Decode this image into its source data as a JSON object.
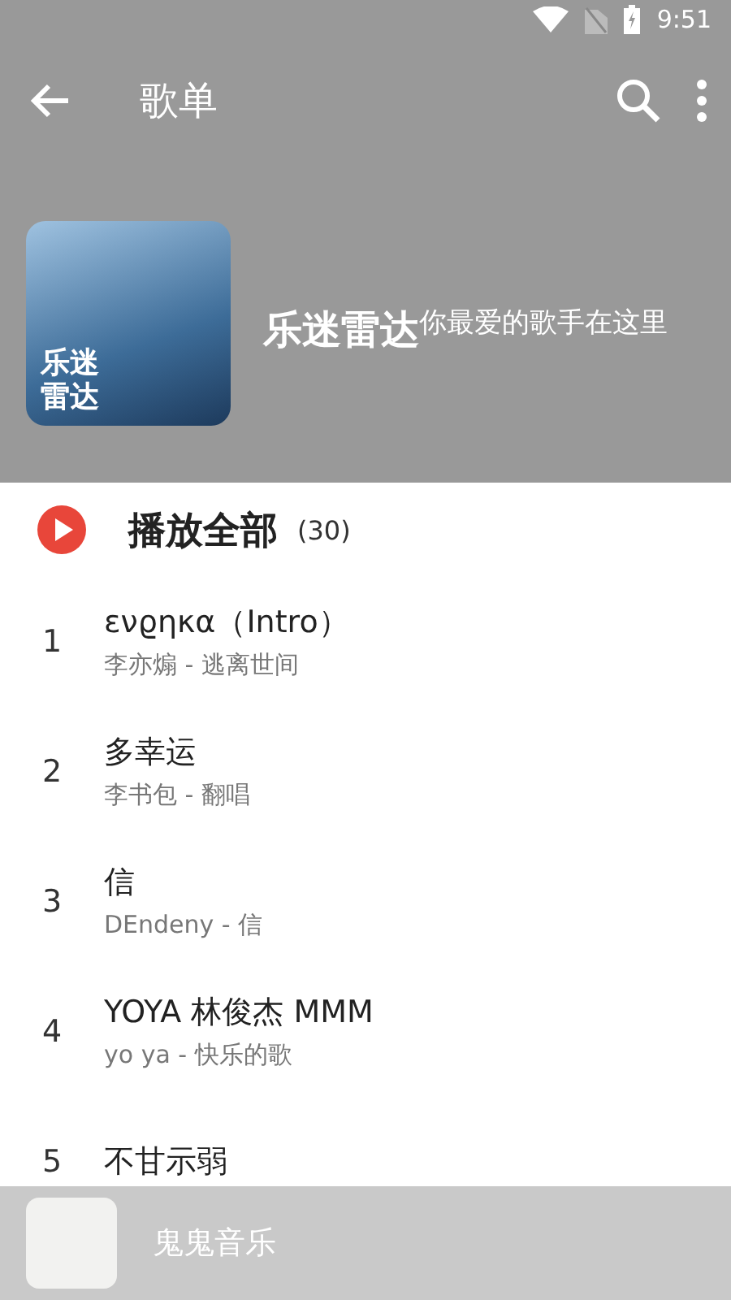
{
  "status_bar": {
    "time": "9:51"
  },
  "app_bar": {
    "title": "歌单"
  },
  "playlist": {
    "title": "乐迷雷达",
    "description": "你最爱的歌手在这里",
    "cover_lines": [
      "乐迷",
      "雷达"
    ]
  },
  "play_all": {
    "label": "播放全部",
    "count": "(30)"
  },
  "songs": [
    {
      "index": "1",
      "title": "ενϱηκα（Intro）",
      "subtitle": "李亦煽 - 逃离世间"
    },
    {
      "index": "2",
      "title": "多幸运",
      "subtitle": "李书包 - 翻唱"
    },
    {
      "index": "3",
      "title": "信",
      "subtitle": "DEndeny - 信"
    },
    {
      "index": "4",
      "title": "YOYA 林俊杰 MMM",
      "subtitle": "yo ya - 快乐的歌"
    },
    {
      "index": "5",
      "title": "不甘示弱"
    }
  ],
  "mini_player": {
    "title": "鬼鬼音乐"
  }
}
